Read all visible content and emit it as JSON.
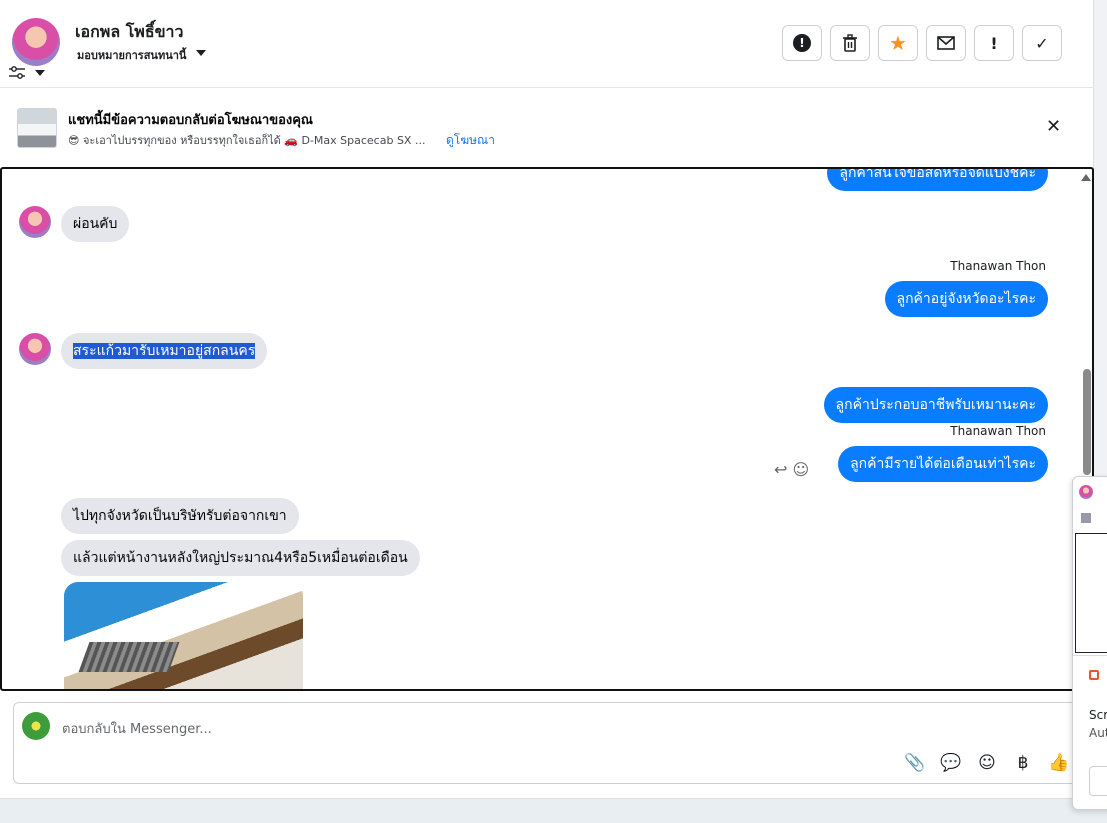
{
  "header": {
    "name": "เอกพล โพธิ์ขาว",
    "assign_label": "มอบหมายการสนทนานี้",
    "toolbar": [
      {
        "icon": "alert-circle-icon",
        "glyph": "!"
      },
      {
        "icon": "trash-icon",
        "glyph": "🗑"
      },
      {
        "icon": "star-icon",
        "glyph": "★"
      },
      {
        "icon": "envelope-icon",
        "glyph": "✉"
      },
      {
        "icon": "exclamation-icon",
        "glyph": "!"
      },
      {
        "icon": "check-icon",
        "glyph": "✓"
      }
    ],
    "colors": {
      "star": "#f7931e"
    }
  },
  "ad_bar": {
    "title": "แชทนี้มีข้อความตอบกลับต่อโฆษณาของคุณ",
    "subtitle": "😎 จะเอาไปบรรทุกของ หรือบรรทุกใจเธอก็ได้ 🚗 D-Max Spacecab SX ...",
    "link": "ดูโฆษณา",
    "close": "✕"
  },
  "chat": {
    "messages": [
      {
        "side": "out",
        "text": "ลูกค้าสนใจข้อสดหรือจัดแบ่งชิคะ"
      },
      {
        "side": "in",
        "text": "ผ่อนคับ"
      },
      {
        "side": "out",
        "sender": "Thanawan Thon",
        "text": "ลูกค้าอยู่จังหวัดอะไรคะ"
      },
      {
        "side": "in",
        "text": "สระแก้วมารับเหมาอยู่สกลนคร",
        "selected": true
      },
      {
        "side": "out",
        "text": "ลูกค้าประกอบอาชีพรับเหมานะคะ"
      },
      {
        "side": "out",
        "sender": "Thanawan Thon",
        "text": "ลูกค้ามีรายได้ต่อเดือนเท่าไรคะ"
      },
      {
        "side": "in",
        "text": "ไปทุกจังหวัดเป็นบริษัทรับต่อจากเขา"
      },
      {
        "side": "in",
        "text": "แล้วแต่หน้างานหลังใหญ่ประมาณ4หรือ5เหมื่อนต่อเดือน"
      }
    ],
    "reaction_icons": "↩ ☺"
  },
  "composer": {
    "placeholder": "ตอบกลับใน Messenger...",
    "icons": [
      {
        "name": "paperclip-icon",
        "glyph": "📎"
      },
      {
        "name": "saved-reply-icon",
        "glyph": "💬"
      },
      {
        "name": "emoji-icon",
        "glyph": "☺"
      },
      {
        "name": "baht-icon",
        "glyph": "฿"
      },
      {
        "name": "thumbs-up-icon",
        "glyph": "👍"
      }
    ]
  },
  "float_widget": {
    "line1": "Scr",
    "line2": "Aut"
  }
}
